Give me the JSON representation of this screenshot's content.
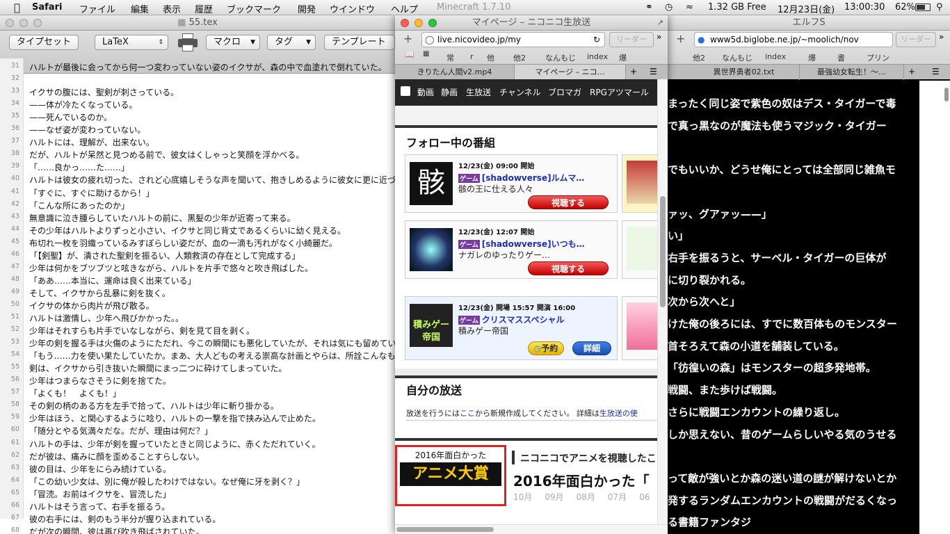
{
  "menubar": {
    "app": "Safari",
    "items": [
      "ファイル",
      "編集",
      "表示",
      "履歴",
      "ブックマーク",
      "開発",
      "ウインドウ",
      "ヘルプ"
    ],
    "background_title": "Minecraft 1.7.10",
    "memory": "1.32 GB Free",
    "date": "12月23日(金)",
    "time": "13:00:30",
    "battery": "62%"
  },
  "editor": {
    "title": "55.tex",
    "toolbar": {
      "typeset": "タイプセット",
      "engine": "LaTeX",
      "macro": "マクロ",
      "tag": "タグ",
      "template": "テンプレート"
    },
    "lines": [
      {
        "n": "31",
        "t": "ハルトが最後に会ってから何一つ変わっていない姿のイクサが、森の中で血塗れで倒れていた。"
      },
      {
        "n": "32",
        "t": ""
      },
      {
        "n": "33",
        "t": "イクサの腹には、聖剣が刺さっている。"
      },
      {
        "n": "34",
        "t": "——体が冷たくなっている。"
      },
      {
        "n": "35",
        "t": "——死んでいるのか。"
      },
      {
        "n": "36",
        "t": "——なぜ姿が変わっていない。"
      },
      {
        "n": "37",
        "t": "ハルトには、理解が、出来ない。"
      },
      {
        "n": "38",
        "t": "だが、ハルトが呆然と見つめる前で、彼女はくしゃっと笑顔を浮かべる。"
      },
      {
        "n": "39",
        "t": "「……良かっ……た……」"
      },
      {
        "n": "40",
        "t": "ハルトは彼女の疲れ切った、されど心底嬉しそうな声を聞いて、抱きしめるように彼女に更に近づ"
      },
      {
        "n": "41",
        "t": "「すぐに、すぐに助けるから！」"
      },
      {
        "n": "42",
        "t": "「こんな所にあったのか」"
      },
      {
        "n": "43",
        "t": "無意識に泣き腫らしていたハルトの前に、黒髪の少年が近寄って来る。"
      },
      {
        "n": "44",
        "t": "その少年はハルトよりずっと小さい、イクサと同じ背丈であるくらいに幼く見える。"
      },
      {
        "n": "45",
        "t": "布切れ一枚を羽織っているみすぼらしい姿だが、血の一滴も汚れがなく小綺麗だ。"
      },
      {
        "n": "46",
        "t": "「【剣聖】が、潰された聖剣を振るい、人類救済の存在として完成する」"
      },
      {
        "n": "47",
        "t": "少年は何かをブツブツと呟きながら、ハルトを片手で悠々と吹き飛ばした。"
      },
      {
        "n": "48",
        "t": "「ああ……本当に、運命は良く出来ている」"
      },
      {
        "n": "49",
        "t": "そして、イクサから乱暴に剣を抜く。"
      },
      {
        "n": "50",
        "t": "イクサの体から肉片が飛び散る。"
      },
      {
        "n": "51",
        "t": "ハルトは激情し、少年へ飛びかかった。。"
      },
      {
        "n": "52",
        "t": "少年はそれすらも片手でいなしながら、剣を見て目を剥く。"
      },
      {
        "n": "53",
        "t": "少年の剣を握る手は火傷のようにただれ、今この瞬間にも悪化していたが、それは気にも留めてい"
      },
      {
        "n": "54",
        "t": "「もう……力を使い果たしていたか。まあ、大人どもの考える崇高な計画とやらは、所詮こんなもの"
      },
      {
        "n": "55",
        "t": "剣は、イクサから引き抜いた瞬間にまっ二つに砕けてしまっていた。"
      },
      {
        "n": "56",
        "t": "少年はつまらなさそうに剣を捨てた。"
      },
      {
        "n": "57",
        "t": "「よくも！　よくも！」"
      },
      {
        "n": "58",
        "t": "その剣の柄のある方を左手で拾って、ハルトは少年に斬り掛かる。"
      },
      {
        "n": "59",
        "t": "少年はほう、と関心するように唸り、ハルトの一撃を指で挟み込んで止めた。"
      },
      {
        "n": "60",
        "t": "「随分とやる気満々だな。だが、理由は何だ？」"
      },
      {
        "n": "61",
        "t": "ハルトの手は、少年が剣を握っていたときと同じように、赤くただれていく。"
      },
      {
        "n": "62",
        "t": "だが彼は、痛みに顔を歪めることすらしない。"
      },
      {
        "n": "63",
        "t": "彼の目は、少年をにらみ続けている。"
      },
      {
        "n": "64",
        "t": "「この幼い少女は、別に俺が殺したわけではない。なぜ俺に牙を剥く？」"
      },
      {
        "n": "65",
        "t": "「冒涜。お前はイクサを、冒涜した」"
      },
      {
        "n": "66",
        "t": "ハルトはそう言って、右手を振るう。"
      },
      {
        "n": "67",
        "t": "彼の右手には、剣のもう半分が握り込まれている。"
      },
      {
        "n": "68",
        "t": "だが次の瞬間、彼は再び吹き飛ばされていた。"
      }
    ]
  },
  "middle": {
    "title": "マイページ – ニコニコ生放送",
    "url": "live.nicovideo.jp/my",
    "reader": "リーダー",
    "bookmarks": [
      "常",
      "r",
      "他",
      "他2",
      "なんもじ",
      "index",
      "爆"
    ],
    "tabs": [
      "きりたん人間v2.mp4",
      "マイページ – ニコ…"
    ],
    "nico_nav": [
      "動画",
      "静画",
      "生放送",
      "チャンネル",
      "ブロマガ",
      "RPGアツマール"
    ],
    "follow_heading": "フォロー中の番組",
    "cards": [
      {
        "time": "12/23(金) 09:00 開始",
        "tag": "ゲーム",
        "title": "[shadowverse]ルムマ…",
        "sub": "骸の王に仕える人々",
        "button": "視聴する",
        "thumb_text": "骸"
      },
      {
        "time": "12/23(金) 12:07 開始",
        "tag": "ゲーム",
        "title": "[shadowverse]いつも…",
        "sub": "ナガレのゆったりゲー…",
        "button": "視聴する",
        "thumb_text": ""
      },
      {
        "time": "12/23(金) 開場 15:57 開演 16:00",
        "tag": "ゲーム",
        "title": "クリスマススペシャル",
        "sub": "積みゲー帝国",
        "reserve": "予約",
        "detail": "詳細",
        "thumb_text": "積みゲー帝国"
      }
    ],
    "own_heading": "自分の放送",
    "own_text_1": "放送を行うには",
    "own_link": "ここ",
    "own_text_2": "から新規作成してください。 詳細は",
    "own_link_2": "生放送の使",
    "banner": {
      "small": "2016年面白かった",
      "big": "アニメ大賞",
      "headline": "ニコニコでアニメを視聴したこ",
      "headline2": "2016年面白かった「",
      "months": [
        "10月",
        "09月",
        "08月",
        "07月",
        "06"
      ]
    }
  },
  "right": {
    "title": "エルフS",
    "url": "www5d.biglobe.ne.jp/~moolich/nov",
    "reader": "リーダー",
    "bookmarks": [
      "他2",
      "なんもじ",
      "index",
      "爆",
      "書",
      "プリン"
    ],
    "tabs": [
      "異世界勇者02.txt",
      "最強幼女転生！〜…"
    ],
    "lines": [
      "まったく同じ姿で紫色の奴はデス・タイガーで毒",
      "で真っ黒なのが魔法も使うマジック・タイガー",
      "",
      "でもいいか、どうせ俺にとっては全部同じ雑魚モ",
      "",
      "ァッ、グアァッ——」",
      "い」",
      "右手を振るうと、サーベル・タイガーの巨体が",
      "に切り裂かれる。",
      "次から次へと」",
      "けた俺の後ろには、すでに数百体ものモンスター",
      "首そろえて森の小道を舗装している。",
      "「彷徨いの森」はモンスターの超多発地帯。",
      "戦闘、また歩けば戦闘。",
      "さらに戦闘エンカウントの繰り返し。",
      "しか思えない、昔のゲームらしいやる気のうせる",
      "",
      "って敵が強いとか森の迷い道の謎が解けないとか",
      "発するランダムエンカウントの戦闘がだるくなっ",
      "る書籍ファンタジ"
    ]
  }
}
